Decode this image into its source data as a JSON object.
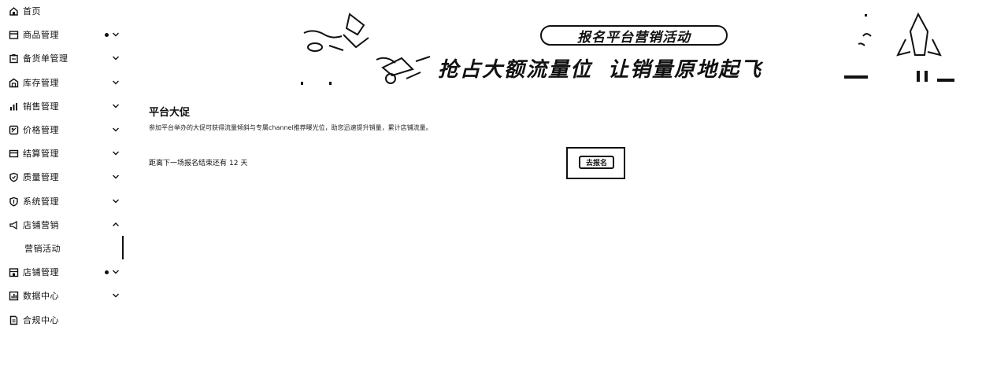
{
  "sidebar": {
    "items": [
      {
        "label": "首页",
        "icon": "home-icon"
      },
      {
        "label": "商品管理",
        "icon": "product-icon",
        "dot": true
      },
      {
        "label": "备货单管理",
        "icon": "clipboard-icon"
      },
      {
        "label": "库存管理",
        "icon": "warehouse-icon"
      },
      {
        "label": "销售管理",
        "icon": "chart-icon"
      },
      {
        "label": "价格管理",
        "icon": "price-tag-icon"
      },
      {
        "label": "结算管理",
        "icon": "wallet-icon"
      },
      {
        "label": "质量管理",
        "icon": "shield-check-icon"
      },
      {
        "label": "系统管理",
        "icon": "shield-icon"
      },
      {
        "label": "店铺营销",
        "icon": "megaphone-icon",
        "expanded": true
      },
      {
        "label": "营销活动",
        "sub": true
      },
      {
        "label": "店铺管理",
        "icon": "store-icon",
        "dot": true
      },
      {
        "label": "数据中心",
        "icon": "data-icon"
      },
      {
        "label": "合规中心",
        "icon": "document-icon"
      }
    ]
  },
  "banner": {
    "pill": "报名平台营销活动",
    "slogan_left": "抢占大额流量位",
    "slogan_right": "让销量原地起飞"
  },
  "content": {
    "title": "平台大促",
    "description": "参加平台举办的大促可获得流量倾斜与专属channel推荐曝光位，助您迅速提升销量，累计店铺流量。",
    "countdown_prefix": "距离下一场报名结束还有",
    "countdown_value": "12",
    "countdown_unit": "天",
    "signup_button": "去报名"
  }
}
